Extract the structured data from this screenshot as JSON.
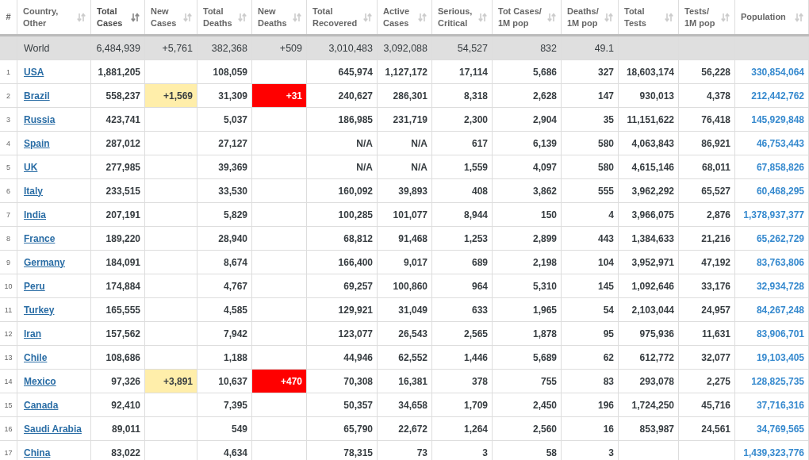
{
  "table": {
    "columns": [
      {
        "label": "#",
        "kind": "index",
        "selected": false
      },
      {
        "label": "Country,\nOther",
        "kind": "sortable",
        "selected": false
      },
      {
        "label": "Total\nCases",
        "kind": "sortable",
        "selected": true
      },
      {
        "label": "New\nCases",
        "kind": "sortable",
        "selected": false
      },
      {
        "label": "Total\nDeaths",
        "kind": "sortable",
        "selected": false
      },
      {
        "label": "New\nDeaths",
        "kind": "sortable",
        "selected": false
      },
      {
        "label": "Total\nRecovered",
        "kind": "sortable",
        "selected": false
      },
      {
        "label": "Active\nCases",
        "kind": "sortable",
        "selected": false
      },
      {
        "label": "Serious,\nCritical",
        "kind": "sortable",
        "selected": false
      },
      {
        "label": "Tot Cases/\n1M pop",
        "kind": "sortable",
        "selected": false
      },
      {
        "label": "Deaths/\n1M pop",
        "kind": "sortable",
        "selected": false
      },
      {
        "label": "Total\nTests",
        "kind": "sortable",
        "selected": false
      },
      {
        "label": "Tests/\n1M pop",
        "kind": "sortable",
        "selected": false
      },
      {
        "label": "Population",
        "kind": "sortable",
        "selected": false
      }
    ],
    "rows": [
      {
        "kind": "total",
        "country": "World",
        "total_cases": "6,484,939",
        "new_cases": "+5,761",
        "total_deaths": "382,368",
        "new_deaths": "+509",
        "total_recovered": "3,010,483",
        "active_cases": "3,092,088",
        "serious_critical": "54,527",
        "cases_per_1m": "832",
        "deaths_per_1m": "49.1"
      },
      {
        "kind": "country",
        "rank": "1",
        "country": "USA",
        "total_cases": "1,881,205",
        "total_deaths": "108,059",
        "total_recovered": "645,974",
        "active_cases": "1,127,172",
        "serious_critical": "17,114",
        "cases_per_1m": "5,686",
        "deaths_per_1m": "327",
        "total_tests": "18,603,174",
        "tests_per_1m": "56,228",
        "population": "330,854,064"
      },
      {
        "kind": "country",
        "rank": "2",
        "country": "Brazil",
        "total_cases": "558,237",
        "new_cases": "+1,569",
        "total_deaths": "31,309",
        "new_deaths": "+31",
        "total_recovered": "240,627",
        "active_cases": "286,301",
        "serious_critical": "8,318",
        "cases_per_1m": "2,628",
        "deaths_per_1m": "147",
        "total_tests": "930,013",
        "tests_per_1m": "4,378",
        "population": "212,442,762"
      },
      {
        "kind": "country",
        "rank": "3",
        "country": "Russia",
        "total_cases": "423,741",
        "total_deaths": "5,037",
        "total_recovered": "186,985",
        "active_cases": "231,719",
        "serious_critical": "2,300",
        "cases_per_1m": "2,904",
        "deaths_per_1m": "35",
        "total_tests": "11,151,622",
        "tests_per_1m": "76,418",
        "population": "145,929,848"
      },
      {
        "kind": "country",
        "rank": "4",
        "country": "Spain",
        "total_cases": "287,012",
        "total_deaths": "27,127",
        "total_recovered": "N/A",
        "active_cases": "N/A",
        "serious_critical": "617",
        "cases_per_1m": "6,139",
        "deaths_per_1m": "580",
        "total_tests": "4,063,843",
        "tests_per_1m": "86,921",
        "population": "46,753,443"
      },
      {
        "kind": "country",
        "rank": "5",
        "country": "UK",
        "total_cases": "277,985",
        "total_deaths": "39,369",
        "total_recovered": "N/A",
        "active_cases": "N/A",
        "serious_critical": "1,559",
        "cases_per_1m": "4,097",
        "deaths_per_1m": "580",
        "total_tests": "4,615,146",
        "tests_per_1m": "68,011",
        "population": "67,858,826"
      },
      {
        "kind": "country",
        "rank": "6",
        "country": "Italy",
        "total_cases": "233,515",
        "total_deaths": "33,530",
        "total_recovered": "160,092",
        "active_cases": "39,893",
        "serious_critical": "408",
        "cases_per_1m": "3,862",
        "deaths_per_1m": "555",
        "total_tests": "3,962,292",
        "tests_per_1m": "65,527",
        "population": "60,468,295"
      },
      {
        "kind": "country",
        "rank": "7",
        "country": "India",
        "total_cases": "207,191",
        "total_deaths": "5,829",
        "total_recovered": "100,285",
        "active_cases": "101,077",
        "serious_critical": "8,944",
        "cases_per_1m": "150",
        "deaths_per_1m": "4",
        "total_tests": "3,966,075",
        "tests_per_1m": "2,876",
        "population": "1,378,937,377"
      },
      {
        "kind": "country",
        "rank": "8",
        "country": "France",
        "total_cases": "189,220",
        "total_deaths": "28,940",
        "total_recovered": "68,812",
        "active_cases": "91,468",
        "serious_critical": "1,253",
        "cases_per_1m": "2,899",
        "deaths_per_1m": "443",
        "total_tests": "1,384,633",
        "tests_per_1m": "21,216",
        "population": "65,262,729"
      },
      {
        "kind": "country",
        "rank": "9",
        "country": "Germany",
        "total_cases": "184,091",
        "total_deaths": "8,674",
        "total_recovered": "166,400",
        "active_cases": "9,017",
        "serious_critical": "689",
        "cases_per_1m": "2,198",
        "deaths_per_1m": "104",
        "total_tests": "3,952,971",
        "tests_per_1m": "47,192",
        "population": "83,763,806"
      },
      {
        "kind": "country",
        "rank": "10",
        "country": "Peru",
        "total_cases": "174,884",
        "total_deaths": "4,767",
        "total_recovered": "69,257",
        "active_cases": "100,860",
        "serious_critical": "964",
        "cases_per_1m": "5,310",
        "deaths_per_1m": "145",
        "total_tests": "1,092,646",
        "tests_per_1m": "33,176",
        "population": "32,934,728"
      },
      {
        "kind": "country",
        "rank": "11",
        "country": "Turkey",
        "total_cases": "165,555",
        "total_deaths": "4,585",
        "total_recovered": "129,921",
        "active_cases": "31,049",
        "serious_critical": "633",
        "cases_per_1m": "1,965",
        "deaths_per_1m": "54",
        "total_tests": "2,103,044",
        "tests_per_1m": "24,957",
        "population": "84,267,248"
      },
      {
        "kind": "country",
        "rank": "12",
        "country": "Iran",
        "total_cases": "157,562",
        "total_deaths": "7,942",
        "total_recovered": "123,077",
        "active_cases": "26,543",
        "serious_critical": "2,565",
        "cases_per_1m": "1,878",
        "deaths_per_1m": "95",
        "total_tests": "975,936",
        "tests_per_1m": "11,631",
        "population": "83,906,701"
      },
      {
        "kind": "country",
        "rank": "13",
        "country": "Chile",
        "total_cases": "108,686",
        "total_deaths": "1,188",
        "total_recovered": "44,946",
        "active_cases": "62,552",
        "serious_critical": "1,446",
        "cases_per_1m": "5,689",
        "deaths_per_1m": "62",
        "total_tests": "612,772",
        "tests_per_1m": "32,077",
        "population": "19,103,405"
      },
      {
        "kind": "country",
        "rank": "14",
        "country": "Mexico",
        "total_cases": "97,326",
        "new_cases": "+3,891",
        "total_deaths": "10,637",
        "new_deaths": "+470",
        "total_recovered": "70,308",
        "active_cases": "16,381",
        "serious_critical": "378",
        "cases_per_1m": "755",
        "deaths_per_1m": "83",
        "total_tests": "293,078",
        "tests_per_1m": "2,275",
        "population": "128,825,735"
      },
      {
        "kind": "country",
        "rank": "15",
        "country": "Canada",
        "total_cases": "92,410",
        "total_deaths": "7,395",
        "total_recovered": "50,357",
        "active_cases": "34,658",
        "serious_critical": "1,709",
        "cases_per_1m": "2,450",
        "deaths_per_1m": "196",
        "total_tests": "1,724,250",
        "tests_per_1m": "45,716",
        "population": "37,716,316"
      },
      {
        "kind": "country",
        "rank": "16",
        "country": "Saudi Arabia",
        "total_cases": "89,011",
        "total_deaths": "549",
        "total_recovered": "65,790",
        "active_cases": "22,672",
        "serious_critical": "1,264",
        "cases_per_1m": "2,560",
        "deaths_per_1m": "16",
        "total_tests": "853,987",
        "tests_per_1m": "24,561",
        "population": "34,769,565"
      },
      {
        "kind": "country",
        "rank": "17",
        "country": "China",
        "total_cases": "83,022",
        "total_deaths": "4,634",
        "total_recovered": "78,315",
        "active_cases": "73",
        "serious_critical": "3",
        "cases_per_1m": "58",
        "deaths_per_1m": "3",
        "population": "1,439,323,776"
      }
    ]
  }
}
